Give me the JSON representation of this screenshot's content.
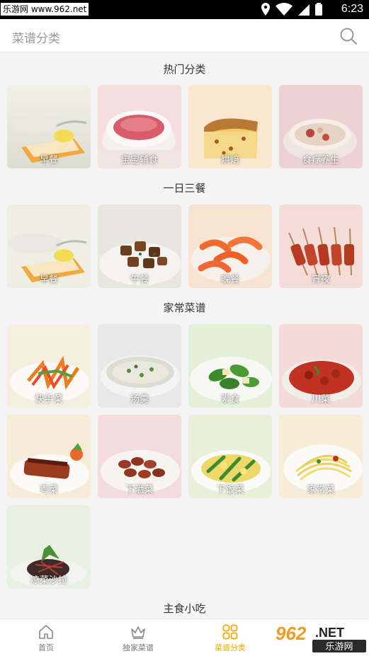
{
  "status_bar": {
    "watermark": "乐游网 www.962.net",
    "time": "6:23"
  },
  "header": {
    "title": "菜谱分类",
    "search_icon": "search-icon"
  },
  "sections": [
    {
      "title": "热门分类",
      "items": [
        "早餐",
        "宝宝辅食",
        "烘焙",
        "食疗养生"
      ]
    },
    {
      "title": "一日三餐",
      "items": [
        "早餐",
        "午餐",
        "晚餐",
        "宵夜"
      ]
    },
    {
      "title": "家常菜谱",
      "items": [
        "快手菜",
        "汤羹",
        "素食",
        "川菜",
        "粤菜",
        "下酒菜",
        "下饭菜",
        "家常菜",
        "凉菜沙拉"
      ]
    },
    {
      "title": "主食小吃",
      "items": []
    }
  ],
  "bottom_nav": {
    "items": [
      {
        "label": "首页",
        "icon": "home-icon"
      },
      {
        "label": "独家菜谱",
        "icon": "crown-icon"
      },
      {
        "label": "菜谱分类",
        "icon": "grid-icon",
        "active": true
      }
    ],
    "active_color": "#f5a800"
  },
  "watermark_logo": {
    "text": "962",
    "suffix": ".NET",
    "subtitle": "乐游网"
  }
}
